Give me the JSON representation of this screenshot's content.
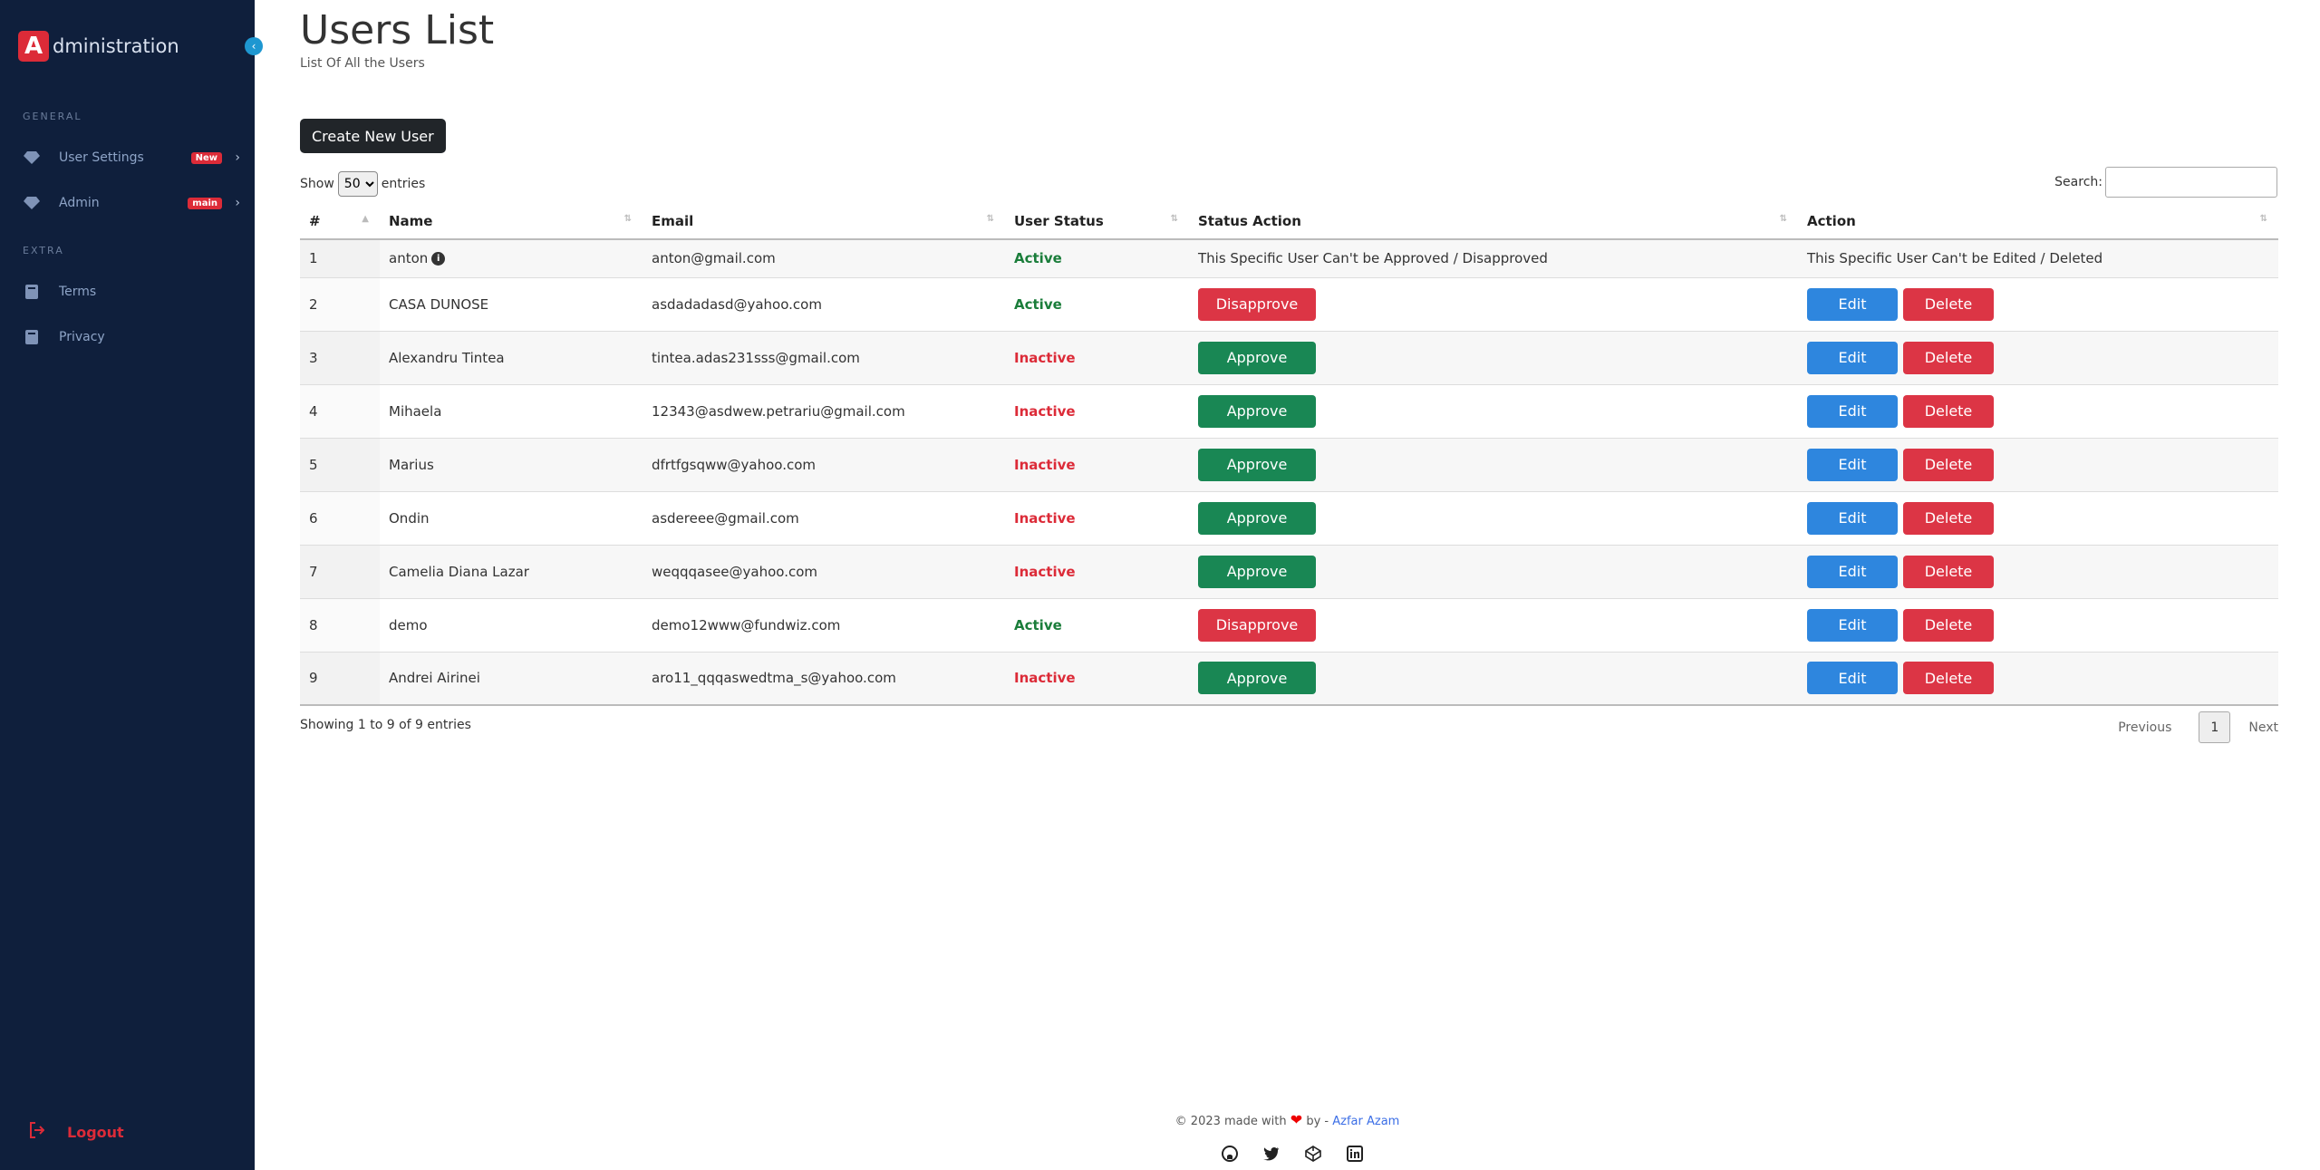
{
  "brand": {
    "logo_letter": "A",
    "text": "dministration"
  },
  "sidebar": {
    "sections": [
      {
        "label": "GENERAL"
      },
      {
        "label": "EXTRA"
      }
    ],
    "items": [
      {
        "label": "User Settings",
        "badge": "New",
        "icon": "diamond-icon"
      },
      {
        "label": "Admin",
        "badge": "main",
        "icon": "diamond-icon"
      },
      {
        "label": "Terms",
        "icon": "book-icon"
      },
      {
        "label": "Privacy",
        "icon": "book-icon"
      }
    ],
    "logout": "Logout"
  },
  "page": {
    "title": "Users List",
    "subtitle": "List Of All the Users",
    "create_button": "Create New User"
  },
  "table_controls": {
    "show_label": "Show",
    "entries_value": "50",
    "entries_label": "entries",
    "search_label": "Search:"
  },
  "table": {
    "headers": [
      "#",
      "Name",
      "Email",
      "User Status",
      "Status Action",
      "Action"
    ],
    "rows": [
      {
        "num": "1",
        "name": "anton",
        "email": "anton@gmail.com",
        "status": "Active",
        "status_action": "This Specific User Can't be Approved / Disapproved",
        "action": "This Specific User Can't be Edited / Deleted"
      },
      {
        "num": "2",
        "name": "CASA DUNOSE",
        "email": "asdadadasd@yahoo.com",
        "status": "Active",
        "status_action": "Disapprove",
        "edit": "Edit",
        "delete": "Delete"
      },
      {
        "num": "3",
        "name": "Alexandru Tintea",
        "email": "tintea.adas231sss@gmail.com",
        "status": "Inactive",
        "status_action": "Approve",
        "edit": "Edit",
        "delete": "Delete"
      },
      {
        "num": "4",
        "name": "Mihaela",
        "email": "12343@asdwew.petrariu@gmail.com",
        "status": "Inactive",
        "status_action": "Approve",
        "edit": "Edit",
        "delete": "Delete"
      },
      {
        "num": "5",
        "name": "Marius",
        "email": "dfrtfgsqww@yahoo.com",
        "status": "Inactive",
        "status_action": "Approve",
        "edit": "Edit",
        "delete": "Delete"
      },
      {
        "num": "6",
        "name": "Ondin",
        "email": "asdereee@gmail.com",
        "status": "Inactive",
        "status_action": "Approve",
        "edit": "Edit",
        "delete": "Delete"
      },
      {
        "num": "7",
        "name": "Camelia Diana Lazar",
        "email": "weqqqasee@yahoo.com",
        "status": "Inactive",
        "status_action": "Approve",
        "edit": "Edit",
        "delete": "Delete"
      },
      {
        "num": "8",
        "name": "demo",
        "email": "demo12www@fundwiz.com",
        "status": "Active",
        "status_action": "Disapprove",
        "edit": "Edit",
        "delete": "Delete"
      },
      {
        "num": "9",
        "name": "Andrei Airinei",
        "email": "aro11_qqqaswedtma_s@yahoo.com",
        "status": "Inactive",
        "status_action": "Approve",
        "edit": "Edit",
        "delete": "Delete"
      }
    ]
  },
  "pagination": {
    "showing": "Showing 1 to 9 of 9 entries",
    "previous": "Previous",
    "current_page": "1",
    "next": "Next"
  },
  "footer": {
    "made_with": "© 2023 made with",
    "by": "by -",
    "author": "Azfar Azam",
    "socials": [
      "github-icon",
      "twitter-icon",
      "codepen-icon",
      "linkedin-icon"
    ]
  },
  "colors": {
    "sidebar_bg": "#0f1f3c",
    "accent_red": "#dc2b38",
    "approve_green": "#198754",
    "edit_blue": "#2e86de"
  }
}
